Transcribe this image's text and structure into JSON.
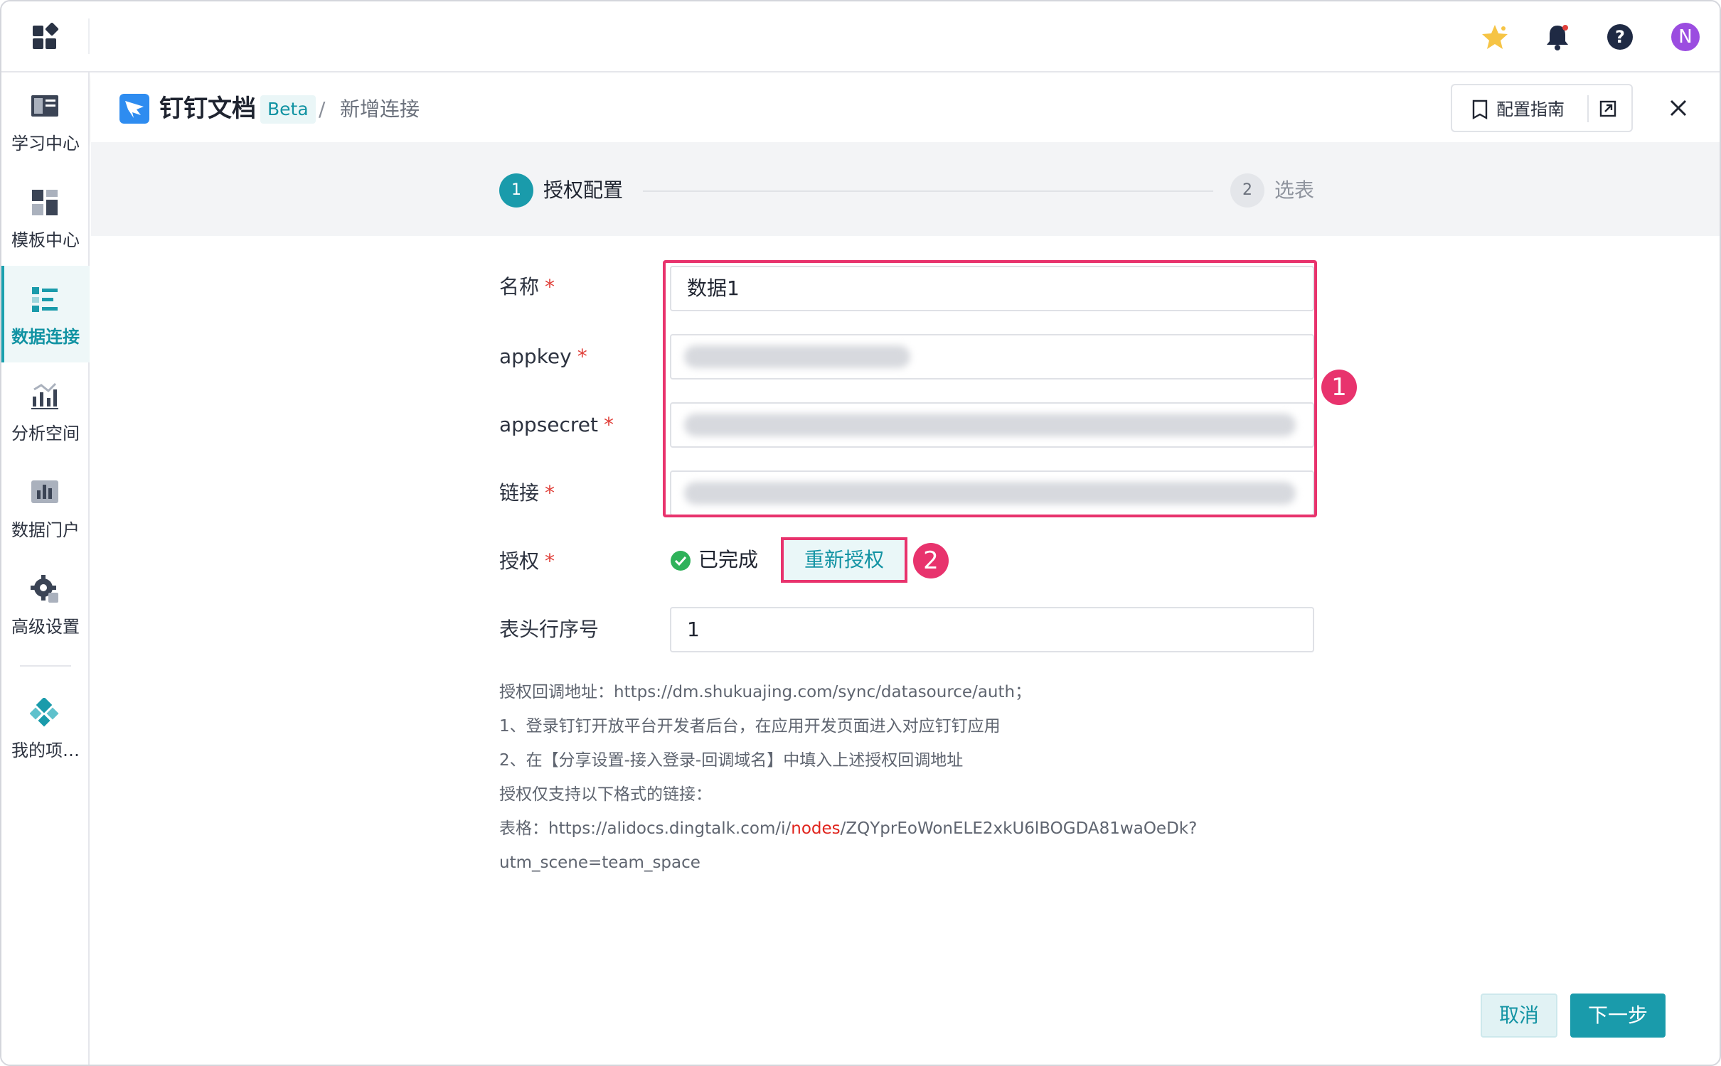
{
  "header": {
    "doc_title": "钉钉文档",
    "beta": "Beta",
    "breadcrumb_sep": "/",
    "breadcrumb_current": "新增连接",
    "guide_label": "配置指南",
    "avatar_letter": "N"
  },
  "sidebar": {
    "items": [
      {
        "label": "学习中心",
        "icon": "book-icon"
      },
      {
        "label": "模板中心",
        "icon": "template-icon"
      },
      {
        "label": "数据连接",
        "icon": "data-connection-icon",
        "active": true
      },
      {
        "label": "分析空间",
        "icon": "analysis-icon"
      },
      {
        "label": "数据门户",
        "icon": "portal-icon"
      },
      {
        "label": "高级设置",
        "icon": "gear-icon"
      },
      {
        "label": "我的项…",
        "icon": "project-icon"
      }
    ]
  },
  "steps": [
    {
      "num": "1",
      "label": "授权配置",
      "active": true
    },
    {
      "num": "2",
      "label": "选表",
      "active": false
    }
  ],
  "form": {
    "name_label": "名称",
    "name_value": "数据1",
    "appkey_label": "appkey",
    "appsecret_label": "appsecret",
    "link_label": "链接",
    "auth_label": "授权",
    "auth_status": "已完成",
    "reauth_button": "重新授权",
    "header_row_label": "表头行序号",
    "header_row_value": "1",
    "required_mark": "*"
  },
  "annotations": {
    "badge1": "1",
    "badge2": "2",
    "color": "#e8336d"
  },
  "help": {
    "line1": "授权回调地址：https://dm.shukuajing.com/sync/datasource/auth；",
    "line2": "1、登录钉钉开放平台开发者后台，在应用开发页面进入对应钉钉应用",
    "line3": "2、在【分享设置-接入登录-回调域名】中填入上述授权回调地址",
    "line4": "授权仅支持以下格式的链接：",
    "line5_prefix": "表格：https://alidocs.dingtalk.com/i/",
    "line5_highlight": "nodes",
    "line5_suffix": "/ZQYprEoWonELE2xkU6lBOGDA81waOeDk?",
    "line6": "utm_scene=team_space"
  },
  "footer": {
    "cancel": "取消",
    "next": "下一步"
  },
  "colors": {
    "accent": "#1a9bab",
    "highlight": "#e8336d",
    "required": "#e0403a"
  }
}
